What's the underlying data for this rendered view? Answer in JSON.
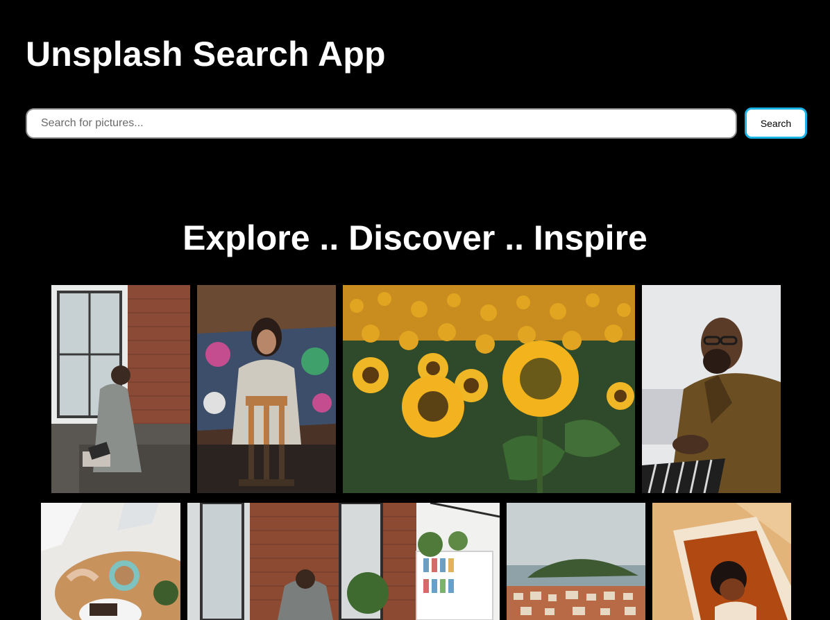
{
  "header": {
    "title": "Unsplash Search App"
  },
  "search": {
    "placeholder": "Search for pictures...",
    "value": "",
    "button_label": "Search"
  },
  "gallery": {
    "heading": "Explore .. Discover .. Inspire"
  },
  "colors": {
    "background": "#000000",
    "text": "#ffffff",
    "button_border": "#19b3e6"
  }
}
